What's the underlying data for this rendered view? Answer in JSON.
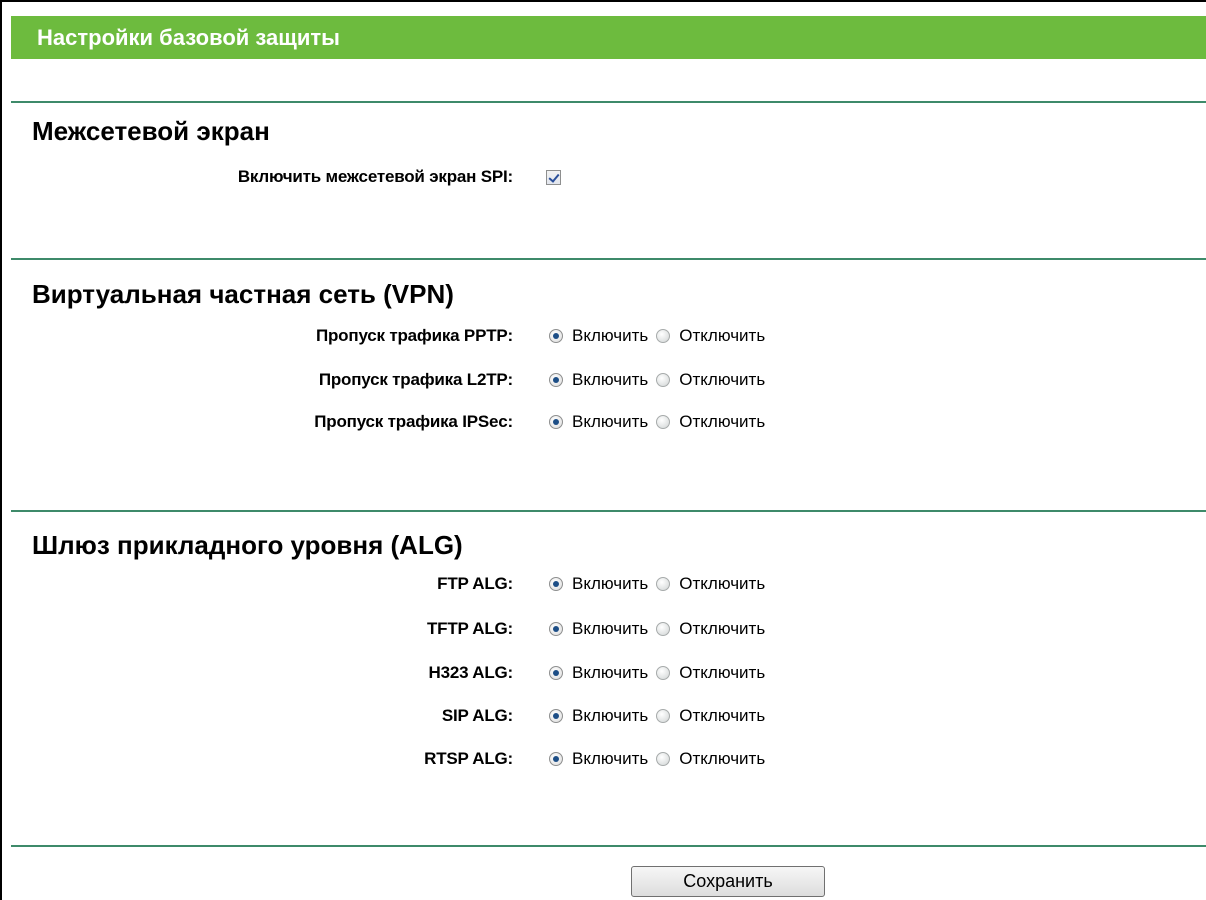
{
  "page_title": "Настройки базовой защиты",
  "firewall": {
    "title": "Межсетевой экран",
    "spi_label": "Включить межсетевой экран SPI:",
    "spi_checked": true
  },
  "vpn": {
    "title": "Виртуальная частная сеть (VPN)",
    "rows": [
      {
        "label": "Пропуск трафика PPTP:",
        "selected": "enable"
      },
      {
        "label": "Пропуск трафика L2TP:",
        "selected": "enable"
      },
      {
        "label": "Пропуск трафика IPSec:",
        "selected": "enable"
      }
    ]
  },
  "alg": {
    "title": "Шлюз прикладного уровня (ALG)",
    "rows": [
      {
        "label": "FTP ALG:",
        "selected": "enable"
      },
      {
        "label": "TFTP ALG:",
        "selected": "enable"
      },
      {
        "label": "H323 ALG:",
        "selected": "enable"
      },
      {
        "label": "SIP ALG:",
        "selected": "enable"
      },
      {
        "label": "RTSP ALG:",
        "selected": "enable"
      }
    ]
  },
  "options": {
    "enable": "Включить",
    "disable": "Отключить"
  },
  "save_label": "Сохранить",
  "colors": {
    "header_bg": "#6dbb3e",
    "divider": "#3e8a6a"
  }
}
